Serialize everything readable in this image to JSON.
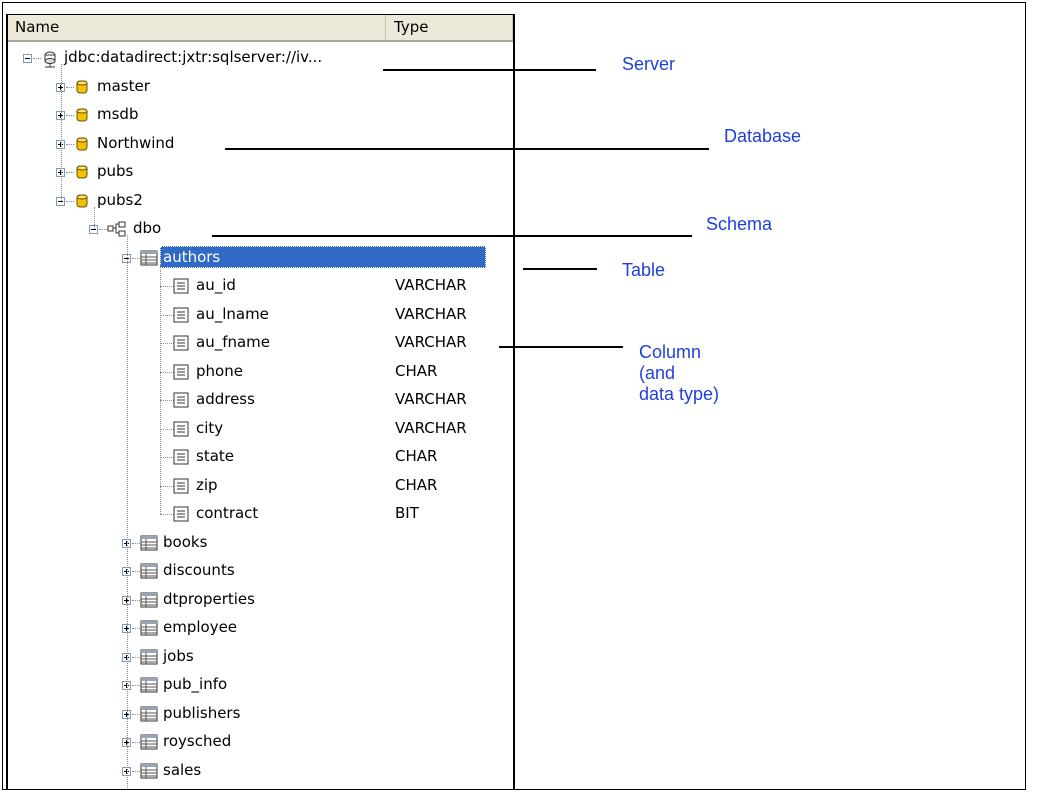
{
  "header": {
    "name_col": "Name",
    "type_col": "Type"
  },
  "server": {
    "label": "jdbc:datadirect:jxtr:sqlserver://iv...",
    "icon": "server-icon"
  },
  "databases": [
    "master",
    "msdb",
    "Northwind",
    "pubs",
    "pubs2"
  ],
  "schema": {
    "label": "dbo",
    "icon": "schema-icon"
  },
  "selected_table": "authors",
  "columns": [
    {
      "name": "au_id",
      "type": "VARCHAR"
    },
    {
      "name": "au_lname",
      "type": "VARCHAR"
    },
    {
      "name": "au_fname",
      "type": "VARCHAR"
    },
    {
      "name": "phone",
      "type": "CHAR"
    },
    {
      "name": "address",
      "type": "VARCHAR"
    },
    {
      "name": "city",
      "type": "VARCHAR"
    },
    {
      "name": "state",
      "type": "CHAR"
    },
    {
      "name": "zip",
      "type": "CHAR"
    },
    {
      "name": "contract",
      "type": "BIT"
    }
  ],
  "other_tables": [
    "books",
    "discounts",
    "dtproperties",
    "employee",
    "jobs",
    "pub_info",
    "publishers",
    "roysched",
    "sales"
  ],
  "callouts": {
    "server": "Server",
    "database": "Database",
    "schema": "Schema",
    "table": "Table",
    "column_line1": "Column",
    "column_line2": "(and",
    "column_line3": "data type)"
  },
  "colors": {
    "selection": "#316ac5",
    "callout_text": "#1f3fdc",
    "db_icon": "#e6b800"
  }
}
